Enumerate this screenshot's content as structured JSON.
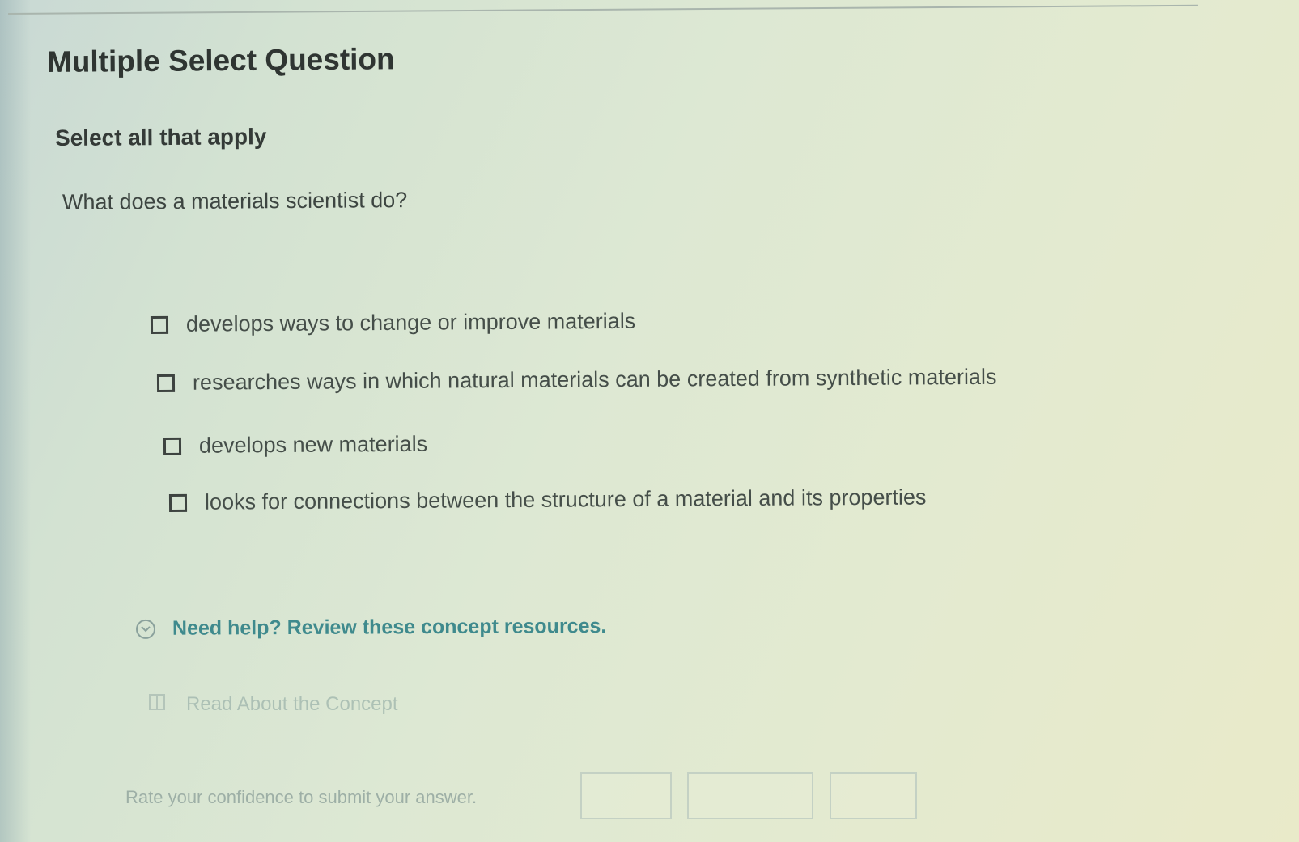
{
  "header": {
    "title": "Multiple Select Question"
  },
  "question": {
    "instruction": "Select all that apply",
    "prompt": "What does a materials scientist do?",
    "options": [
      {
        "label": "develops ways to change or improve materials",
        "checked": false
      },
      {
        "label": "researches ways in which natural materials can be created from synthetic materials",
        "checked": false
      },
      {
        "label": "develops new materials",
        "checked": false
      },
      {
        "label": "looks for connections between the structure of a material and its properties",
        "checked": false
      }
    ]
  },
  "help": {
    "icon": "chevron-down-circle-icon",
    "label": "Need help? Review these concept resources.",
    "resource": {
      "icon": "book-icon",
      "label": "Read About the Concept"
    }
  },
  "confidence": {
    "label": "Rate your confidence to submit your answer.",
    "buttons": [
      {
        "label": ""
      },
      {
        "label": ""
      },
      {
        "label": ""
      }
    ]
  },
  "colors": {
    "accent": "#3f8a8d",
    "text": "#3a3f3c"
  }
}
